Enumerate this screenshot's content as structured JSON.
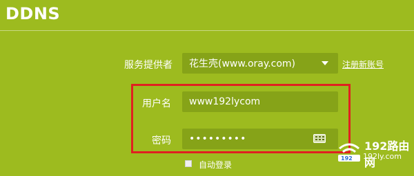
{
  "page": {
    "title": "DDNS"
  },
  "form": {
    "provider": {
      "label": "服务提供者",
      "value": "花生壳(www.oray.com)",
      "register_link": "注册新账号"
    },
    "username": {
      "label": "用户名",
      "value": "www192lycom"
    },
    "password": {
      "label": "密码",
      "value": "•••••••••"
    },
    "auto_login": {
      "label": "自动登录",
      "checked": false
    }
  },
  "watermark": {
    "top_text": "192路由网",
    "bottom_text": "192ly.com"
  },
  "colors": {
    "background": "#9dbb1f",
    "field": "#86a318",
    "highlight": "#e02020"
  }
}
